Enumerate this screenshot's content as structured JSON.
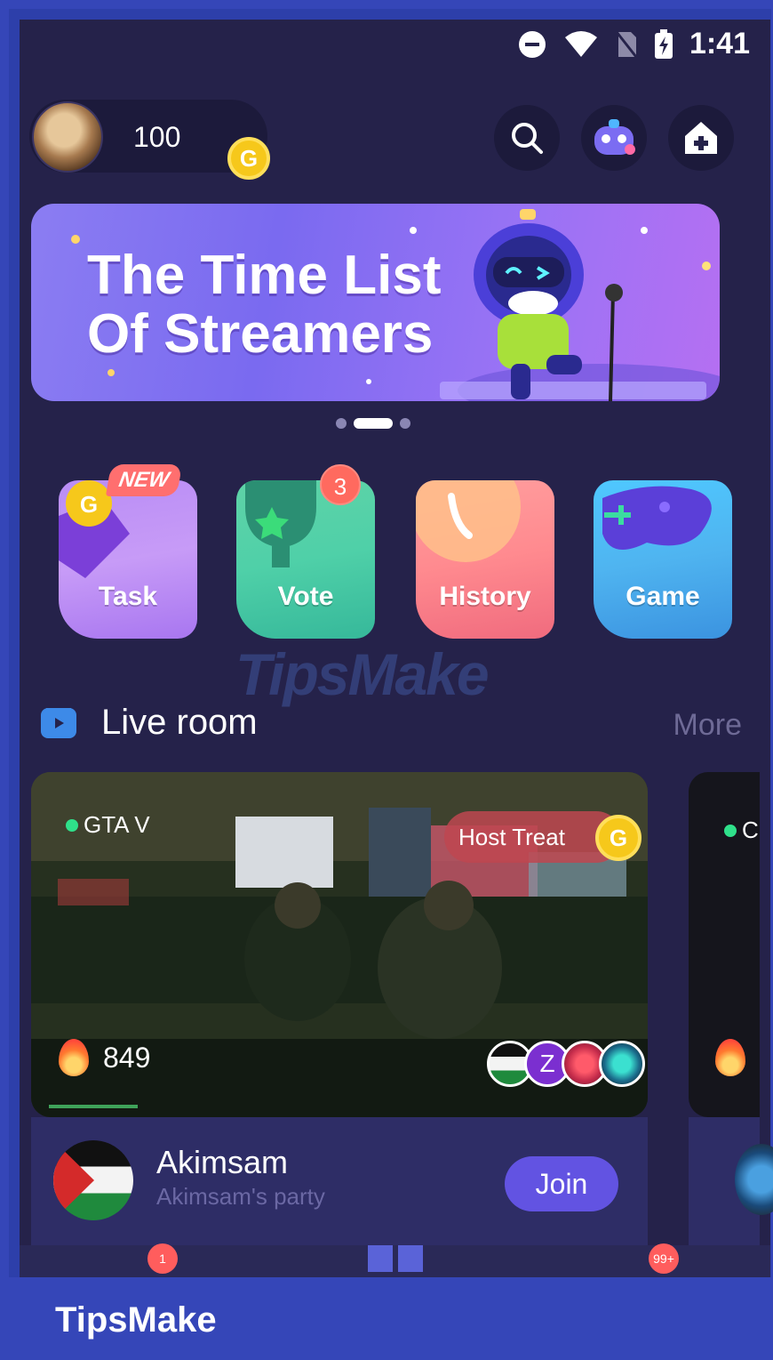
{
  "status_bar": {
    "time": "1:41"
  },
  "header": {
    "coins": "100",
    "coin_symbol": "G"
  },
  "banner": {
    "title_line1": "The Time List",
    "title_line2": "Of Streamers"
  },
  "tiles": [
    {
      "label": "Task",
      "badge": "NEW"
    },
    {
      "label": "Vote",
      "badge": "3"
    },
    {
      "label": "History"
    },
    {
      "label": "Game"
    }
  ],
  "watermark_mid": "TipsMake",
  "live_room": {
    "title": "Live room",
    "more": "More",
    "card": {
      "game": "GTA V",
      "host_treat": "Host Treat",
      "viewers": "849",
      "host_name": "Akimsam",
      "room_name": "Akimsam's party",
      "join": "Join",
      "avatar_letter": "Z"
    },
    "card2_game_peek": "C"
  },
  "bottom_nav": {
    "badge_left": "1",
    "badge_right": "99+"
  },
  "brand": "TipsMake",
  "colors": {
    "background": "#25224a",
    "frame": "#2d3faa",
    "accent": "#6253e2",
    "coin": "#f6c81b"
  }
}
